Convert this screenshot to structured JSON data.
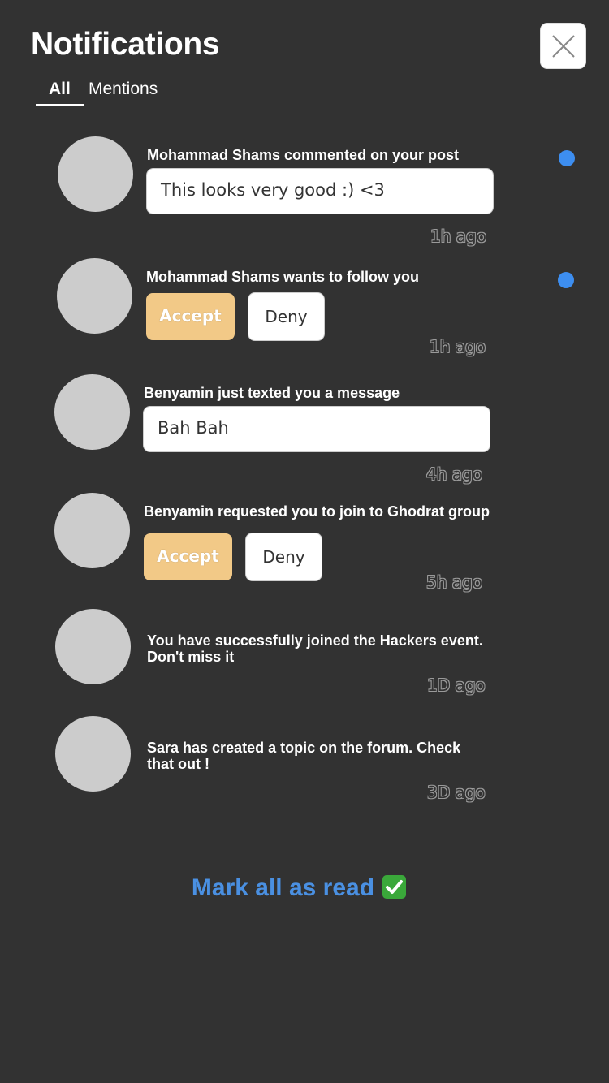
{
  "header": {
    "title": "Notifications",
    "close_icon": "close-icon"
  },
  "tabs": [
    {
      "label": "All",
      "active": true
    },
    {
      "label": "Mentions",
      "active": false
    }
  ],
  "notifications": [
    {
      "title": "Mohammad Shams commented on your post",
      "message": "This looks very good :) <3",
      "time": "1h ago",
      "unread": true
    },
    {
      "title": "Mohammad Shams wants to follow you",
      "accept_label": "Accept",
      "deny_label": "Deny",
      "time": "1h ago",
      "unread": true
    },
    {
      "title": "Benyamin just texted you a message",
      "message": "Bah Bah",
      "time": "4h ago",
      "unread": false
    },
    {
      "title": "Benyamin requested you to join to Ghodrat group",
      "accept_label": "Accept",
      "deny_label": "Deny",
      "time": "5h ago",
      "unread": false
    },
    {
      "title": "You have successfully joined the Hackers event. Don't miss it",
      "time": "1D ago",
      "unread": false
    },
    {
      "title": "Sara has created a topic on the forum. Check that out !",
      "time": "3D ago",
      "unread": false
    }
  ],
  "footer": {
    "mark_all_label": "Mark all as read",
    "mark_all_icon": "check-mark-icon"
  },
  "colors": {
    "background": "#323232",
    "accept": "#f2c987",
    "unread_dot": "#3d8ef0",
    "link": "#4a90e2",
    "avatar": "#cccccc"
  }
}
